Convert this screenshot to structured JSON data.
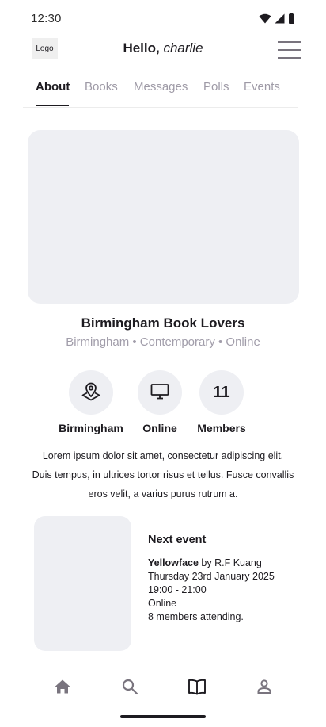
{
  "status_bar": {
    "time": "12:30",
    "icons": [
      "wifi-icon",
      "cellular-icon",
      "battery-icon"
    ]
  },
  "header": {
    "logo_text": "Logo",
    "greeting_prefix": "Hello, ",
    "user_name": "charlie",
    "menu_icon": "hamburger-menu-icon"
  },
  "tabs": [
    {
      "label": "About",
      "active": true
    },
    {
      "label": "Books",
      "active": false
    },
    {
      "label": "Messages",
      "active": false
    },
    {
      "label": "Polls",
      "active": false
    },
    {
      "label": "Events",
      "active": false
    }
  ],
  "club": {
    "name": "Birmingham Book Lovers",
    "meta": "Birmingham • Contemporary • Online"
  },
  "stats": [
    {
      "icon": "location-pin-icon",
      "label": "Birmingham"
    },
    {
      "icon": "monitor-icon",
      "label": "Online"
    },
    {
      "value": "11",
      "label": "Members"
    }
  ],
  "description": "Lorem ipsum dolor sit amet, consectetur adipiscing elit. Duis tempus,  in ultrices tortor risus et tellus. Fusce convallis eros velit, a varius purus rutrum a.",
  "next_event": {
    "heading": "Next event",
    "book_title": "Yellowface",
    "book_author": " by R.F Kuang",
    "date": "Thursday 23rd January 2025",
    "time": "19:00 - 21:00",
    "location": "Online",
    "attending": "8 members attending."
  },
  "bottom_nav": [
    {
      "icon": "home-icon"
    },
    {
      "icon": "search-icon"
    },
    {
      "icon": "book-icon"
    },
    {
      "icon": "profile-icon"
    }
  ],
  "colors": {
    "text_primary": "#1d1b20",
    "text_muted": "#9e9aa6",
    "placeholder_fill": "#eeeff3",
    "icon_gray": "#79747e"
  }
}
